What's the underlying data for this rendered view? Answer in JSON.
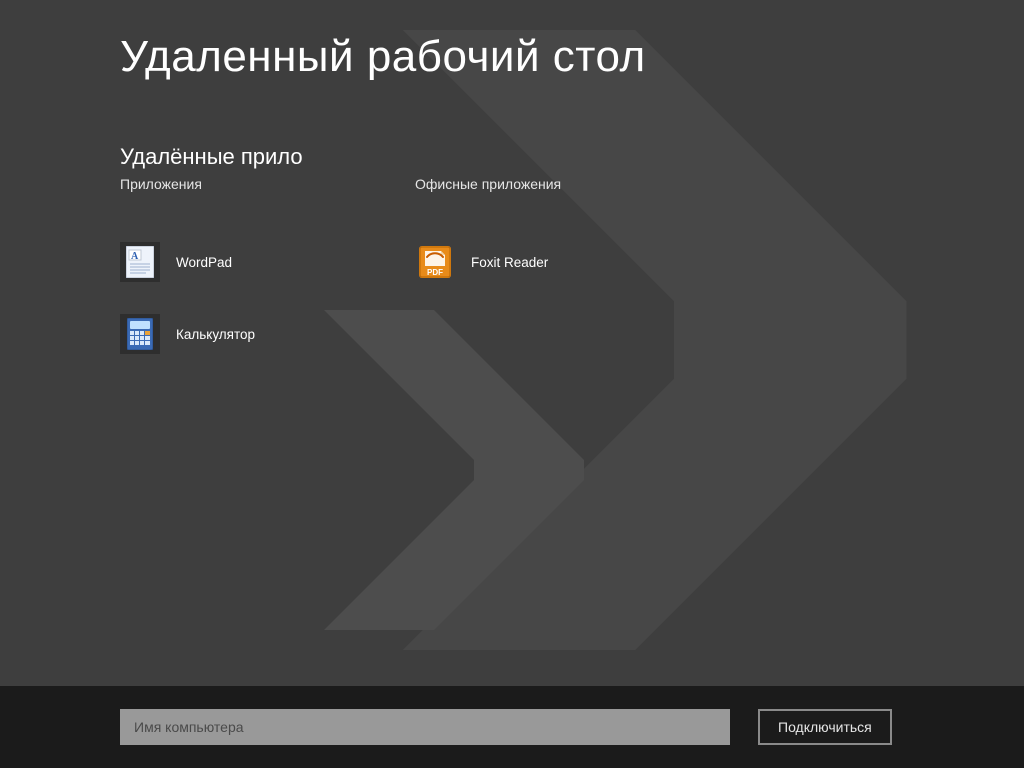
{
  "page_title": "Удаленный рабочий стол",
  "section_title": "Удалённые прило",
  "columns": [
    {
      "header": "Приложения",
      "items": [
        {
          "label": "WordPad",
          "icon": "wordpad-icon"
        },
        {
          "label": "Калькулятор",
          "icon": "calculator-icon"
        }
      ]
    },
    {
      "header": "Офисные приложения",
      "items": [
        {
          "label": "Foxit Reader",
          "icon": "foxit-reader-icon"
        }
      ]
    }
  ],
  "bottom": {
    "computer_placeholder": "Имя компьютера",
    "connect_label": "Подключиться"
  },
  "colors": {
    "background": "#3e3e3e",
    "bottom_bar": "#1b1b1b",
    "input_bg": "#999999",
    "foxit_orange": "#e88b1a"
  }
}
